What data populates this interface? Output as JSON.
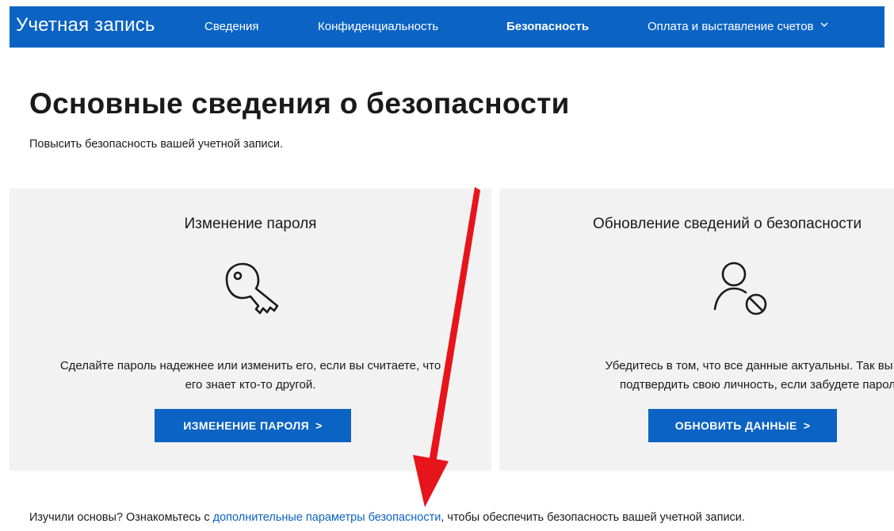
{
  "nav": {
    "brand": "Учетная запись",
    "items": [
      {
        "label": "Сведения",
        "active": false
      },
      {
        "label": "Конфиденциальность",
        "active": false
      },
      {
        "label": "Безопасность",
        "active": true
      },
      {
        "label": "Оплата и выставление счетов",
        "active": false,
        "has_dropdown": true
      }
    ]
  },
  "page": {
    "title": "Основные сведения о безопасности",
    "subtitle": "Повысить безопасность вашей учетной записи."
  },
  "cards": {
    "password": {
      "title": "Изменение пароля",
      "icon": "key-icon",
      "desc_line1": "Сделайте пароль надежнее или изменить его, если вы считаете, что",
      "desc_line2": "его знает кто-то другой.",
      "button_label": "ИЗМЕНЕНИЕ ПАРОЛЯ",
      "button_chevron": ">"
    },
    "security_info": {
      "title": "Обновление сведений о безопасности",
      "icon": "user-blocked-icon",
      "desc_line1": "Убедитесь в том, что все данные актуальны. Так вы см",
      "desc_line2": "подтвердить свою личность, если забудете парол",
      "button_label": "ОБНОВИТЬ ДАННЫЕ",
      "button_chevron": ">"
    }
  },
  "footer": {
    "prefix": "Изучили основы? Ознакомьтесь с ",
    "link": "дополнительные параметры безопасности",
    "suffix": ", чтобы обеспечить безопасность вашей учетной записи."
  },
  "colors": {
    "brand_blue": "#0b63c4",
    "card_bg": "#f2f2f2",
    "annotation_red": "#e8141b"
  }
}
